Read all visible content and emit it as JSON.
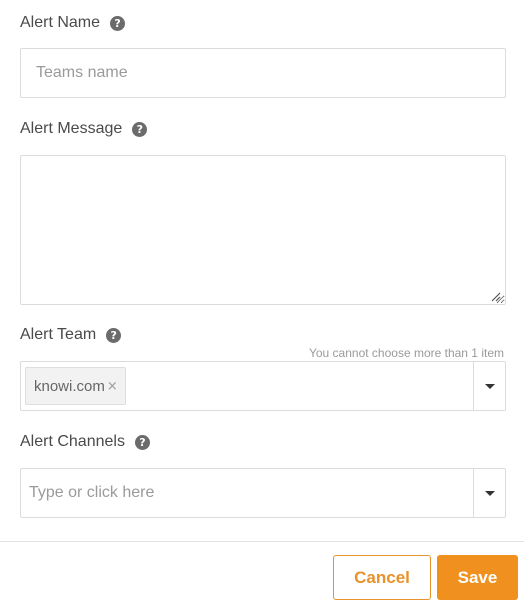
{
  "alert_name": {
    "label": "Alert Name",
    "placeholder": "Teams name",
    "value": ""
  },
  "alert_message": {
    "label": "Alert Message",
    "value": ""
  },
  "alert_team": {
    "label": "Alert Team",
    "hint": "You cannot choose more than 1 item",
    "selected_tags": [
      "knowi.com"
    ],
    "remove_symbol": "×"
  },
  "alert_channels": {
    "label": "Alert Channels",
    "placeholder": "Type or click here"
  },
  "help_symbol": "?",
  "footer": {
    "cancel_label": "Cancel",
    "save_label": "Save"
  },
  "colors": {
    "accent": "#f0901e",
    "border": "#dcdcdc",
    "label": "#4a4a4a",
    "placeholder": "#9a9a9a"
  },
  "icons": [
    "help-icon",
    "chevron-down-icon",
    "close-icon",
    "resize-grip-icon"
  ]
}
